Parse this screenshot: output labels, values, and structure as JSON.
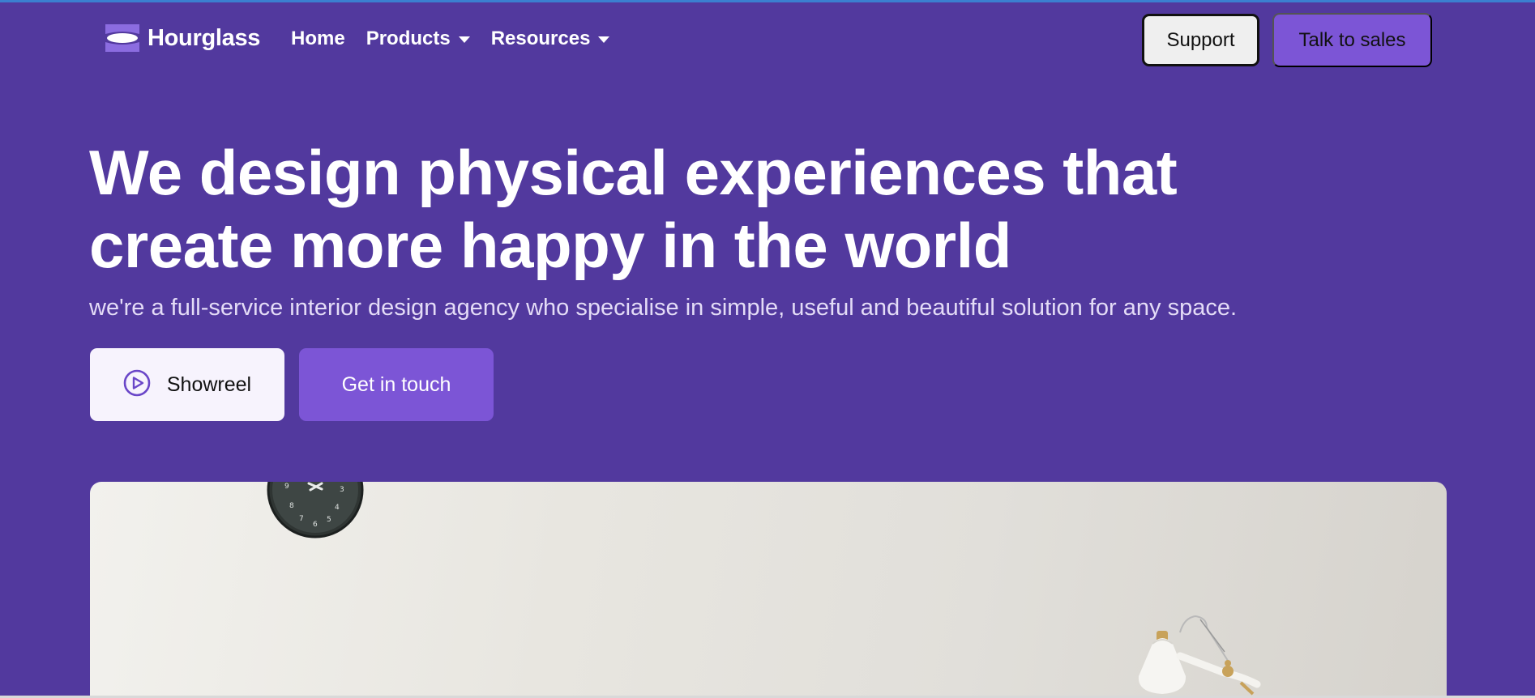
{
  "brand": {
    "name": "Hourglass",
    "icon": "hourglass-logo-icon"
  },
  "nav": {
    "links": [
      {
        "label": "Home",
        "has_dropdown": false
      },
      {
        "label": "Products",
        "has_dropdown": true
      },
      {
        "label": "Resources",
        "has_dropdown": true
      }
    ],
    "support_label": "Support",
    "sales_label": "Talk to sales"
  },
  "hero": {
    "title_line1": "We design physical experiences that",
    "title_line2": "create more happy in the world",
    "subtitle": "we're a full-service interior design agency who specialise in simple, useful and beautiful solution for any space.",
    "showreel_label": "Showreel",
    "showreel_icon": "play-circle-icon",
    "touch_label": "Get in touch",
    "image_subject": [
      "wall-clock",
      "desk-lamp"
    ]
  },
  "colors": {
    "background": "#52399e",
    "accent": "#7c55d6",
    "light_button": "#f7f3fd",
    "text_light": "#ffffff"
  }
}
